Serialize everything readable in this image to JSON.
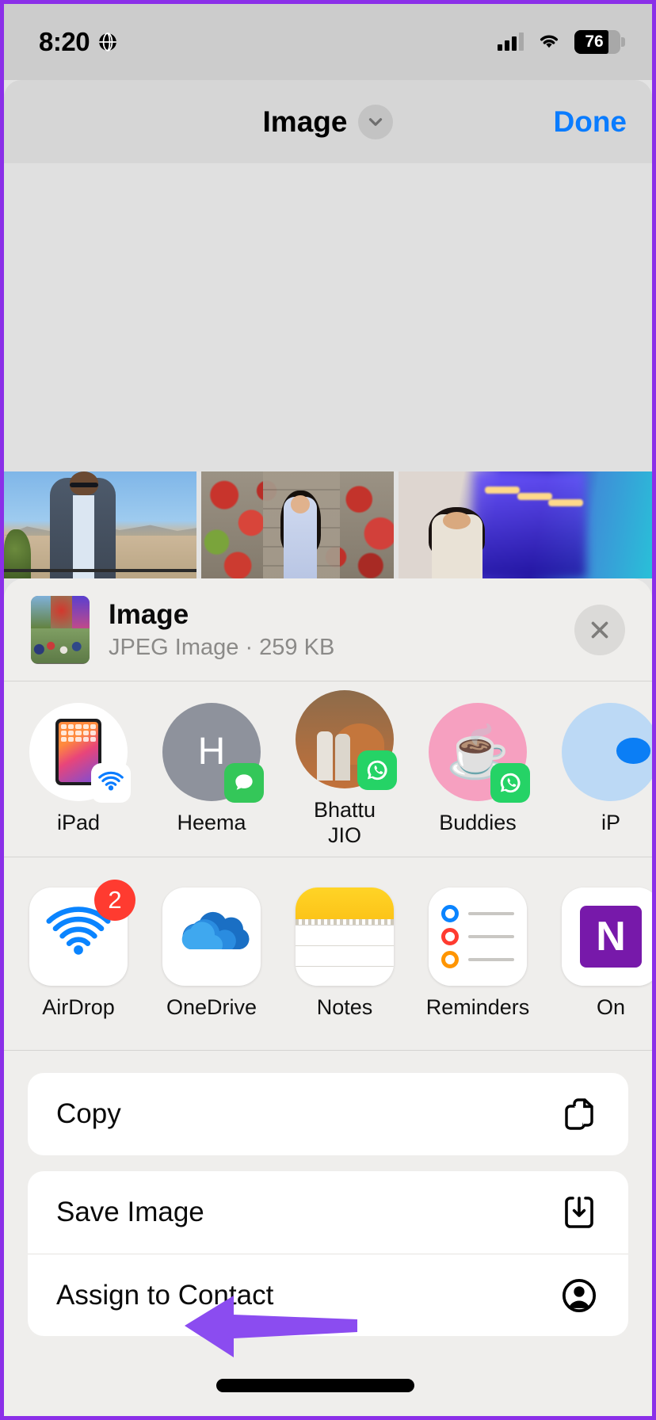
{
  "status_bar": {
    "time": "8:20",
    "location_icon": "globe-icon",
    "cellular_icon": "cellular-signal-icon",
    "wifi_icon": "wifi-icon",
    "battery_level": "76",
    "battery_icon": "battery-icon"
  },
  "nav_bar": {
    "title": "Image",
    "chevron_icon": "chevron-down-icon",
    "done_label": "Done"
  },
  "file_header": {
    "title": "Image",
    "subtitle": "JPEG Image · 259 KB",
    "close_icon": "close-icon"
  },
  "contacts": [
    {
      "label": "iPad",
      "avatar_type": "ipad-device",
      "badge": "airdrop-badge-icon",
      "initial": ""
    },
    {
      "label": "Heema",
      "avatar_type": "initial",
      "badge": "messages-badge-icon",
      "initial": "H"
    },
    {
      "label": "Bhattu JIO",
      "avatar_type": "photo",
      "badge": "whatsapp-badge-icon",
      "initial": ""
    },
    {
      "label": "Buddies",
      "avatar_type": "emoji",
      "badge": "whatsapp-badge-icon",
      "initial": "☕"
    },
    {
      "label": "iP",
      "avatar_type": "partial",
      "badge": "",
      "initial": ""
    }
  ],
  "apps": [
    {
      "label": "AirDrop",
      "icon": "airdrop-icon",
      "badge": "2"
    },
    {
      "label": "OneDrive",
      "icon": "onedrive-icon",
      "badge": ""
    },
    {
      "label": "Notes",
      "icon": "notes-icon",
      "badge": ""
    },
    {
      "label": "Reminders",
      "icon": "reminders-icon",
      "badge": ""
    },
    {
      "label": "On",
      "icon": "onenote-icon",
      "badge": "",
      "letter": "N"
    }
  ],
  "action_rows": [
    {
      "label": "Copy",
      "icon": "copy-icon"
    },
    {
      "label": "Save Image",
      "icon": "save-download-icon"
    },
    {
      "label": "Assign to Contact",
      "icon": "contact-person-icon"
    }
  ],
  "annotations": {
    "arrow_color": "#8b4cf0",
    "arrow_target": "Save Image",
    "redaction_bar_color": "#000000"
  },
  "colors": {
    "accent_blue": "#0a7cff",
    "sheet_bg": "#efeeec",
    "preview_bg": "#e0e0e0",
    "status_bg": "#cccccc",
    "frame_border": "#8b2fe8",
    "badge_red": "#ff3b30",
    "whatsapp_green": "#25d366",
    "messages_green": "#34c759"
  }
}
